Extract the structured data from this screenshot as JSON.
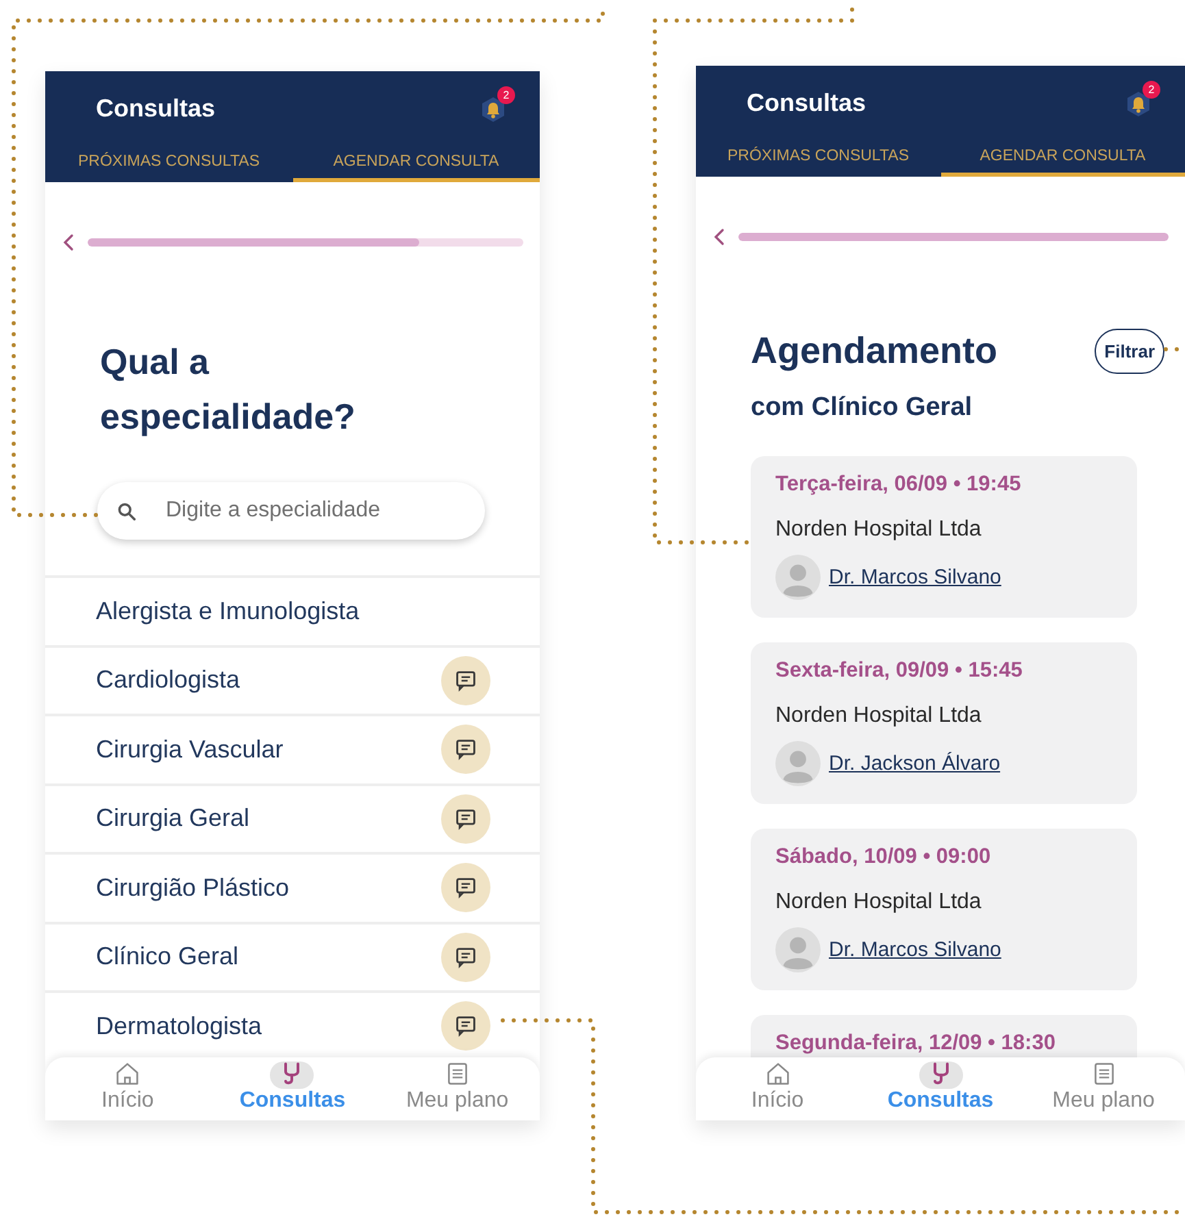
{
  "screens": [
    {
      "kind": "specialty",
      "header": {
        "title": "Consultas",
        "badge": "2"
      },
      "tabs": [
        {
          "label": "PRÓXIMAS CONSULTAS",
          "selected": false
        },
        {
          "label": "AGENDAR CONSULTA",
          "selected": true
        }
      ],
      "progress": {
        "level": 0.76
      },
      "heading": "Qual a especialidade?",
      "search": {
        "placeholder": "Digite a especialidade"
      },
      "specialties": [
        {
          "name": "Alergista e Imunologista",
          "chat": false
        },
        {
          "name": "Cardiologista",
          "chat": true
        },
        {
          "name": "Cirurgia Vascular",
          "chat": true
        },
        {
          "name": "Cirurgia Geral",
          "chat": true
        },
        {
          "name": "Cirurgião Plástico",
          "chat": true
        },
        {
          "name": "Clínico Geral",
          "chat": true
        },
        {
          "name": "Dermatologista",
          "chat": true
        }
      ],
      "nav": [
        {
          "label": "Início",
          "selected": false
        },
        {
          "label": "Consultas",
          "selected": true
        },
        {
          "label": "Meu plano",
          "selected": false
        }
      ]
    },
    {
      "kind": "schedule",
      "header": {
        "title": "Consultas",
        "badge": "2"
      },
      "tabs": [
        {
          "label": "PRÓXIMAS CONSULTAS",
          "selected": false
        },
        {
          "label": "AGENDAR CONSULTA",
          "selected": true
        }
      ],
      "progress": {
        "level": 1
      },
      "heading": "Agendamento",
      "subheading": "com Clínico Geral",
      "filter_button": "Filtrar",
      "appointments": [
        {
          "date": "Terça-feira, 06/09 • 19:45",
          "hospital": "Norden Hospital Ltda",
          "doctor": "Dr. Marcos Silvano"
        },
        {
          "date": "Sexta-feira, 09/09 • 15:45",
          "hospital": "Norden Hospital Ltda",
          "doctor": "Dr. Jackson Álvaro"
        },
        {
          "date": "Sábado, 10/09 • 09:00",
          "hospital": "Norden Hospital Ltda",
          "doctor": "Dr. Marcos Silvano"
        },
        {
          "date": "Segunda-feira, 12/09 • 18:30"
        }
      ],
      "nav": [
        {
          "label": "Início",
          "selected": false
        },
        {
          "label": "Consultas",
          "selected": true
        },
        {
          "label": "Meu plano",
          "selected": false
        }
      ]
    }
  ]
}
